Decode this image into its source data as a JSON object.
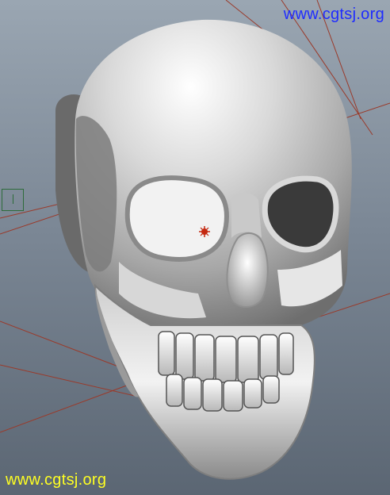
{
  "watermark": {
    "top": "www.cgtsj.org",
    "bottom": "www.cgtsj.org",
    "top_color": "#1f2cff",
    "bottom_color": "#ffff22"
  },
  "viewport": {
    "subject": "skull-model",
    "guide_line_color": "#9a3a2a",
    "pivot_color": "#c42810",
    "side_marker_color": "#2d6b3a"
  }
}
